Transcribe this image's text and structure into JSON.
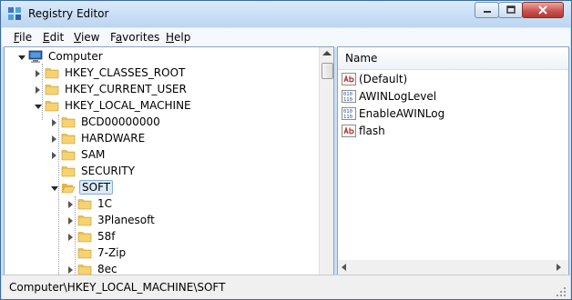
{
  "window": {
    "title": "Registry Editor"
  },
  "menu": [
    {
      "accel": "F",
      "rest": "ile"
    },
    {
      "accel": "E",
      "rest": "dit"
    },
    {
      "accel": "V",
      "rest": "iew"
    },
    {
      "pre": "F",
      "accel": "a",
      "rest": "vorites"
    },
    {
      "accel": "H",
      "rest": "elp"
    }
  ],
  "tree": [
    {
      "label": "Computer",
      "level": 0,
      "state": "expanded",
      "icon": "computer-icon"
    },
    {
      "label": "HKEY_CLASSES_ROOT",
      "level": 1,
      "state": "collapsed",
      "icon": "folder-icon"
    },
    {
      "label": "HKEY_CURRENT_USER",
      "level": 1,
      "state": "collapsed",
      "icon": "folder-icon"
    },
    {
      "label": "HKEY_LOCAL_MACHINE",
      "level": 1,
      "state": "expanded",
      "icon": "folder-icon"
    },
    {
      "label": "BCD00000000",
      "level": 2,
      "state": "collapsed",
      "icon": "folder-icon"
    },
    {
      "label": "HARDWARE",
      "level": 2,
      "state": "collapsed",
      "icon": "folder-icon"
    },
    {
      "label": "SAM",
      "level": 2,
      "state": "collapsed",
      "icon": "folder-icon"
    },
    {
      "label": "SECURITY",
      "level": 2,
      "state": "none",
      "icon": "folder-icon"
    },
    {
      "label": "SOFT",
      "level": 2,
      "state": "expanded",
      "icon": "folder-open-icon",
      "selected": true
    },
    {
      "label": "1C",
      "level": 3,
      "state": "collapsed",
      "icon": "folder-icon"
    },
    {
      "label": "3Planesoft",
      "level": 3,
      "state": "collapsed",
      "icon": "folder-icon"
    },
    {
      "label": "58f",
      "level": 3,
      "state": "collapsed",
      "icon": "folder-icon"
    },
    {
      "label": "7-Zip",
      "level": 3,
      "state": "none",
      "icon": "folder-icon"
    },
    {
      "label": "8ec",
      "level": 3,
      "state": "collapsed",
      "icon": "folder-icon"
    }
  ],
  "values_pane": {
    "column_name": "Name",
    "items": [
      {
        "name": "(Default)",
        "icon": "string-value-icon"
      },
      {
        "name": "AWINLogLevel",
        "icon": "binary-value-icon"
      },
      {
        "name": "EnableAWINLog",
        "icon": "binary-value-icon"
      },
      {
        "name": "flash",
        "icon": "string-value-icon"
      }
    ]
  },
  "status": {
    "path": "Computer\\HKEY_LOCAL_MACHINE\\SOFT"
  }
}
